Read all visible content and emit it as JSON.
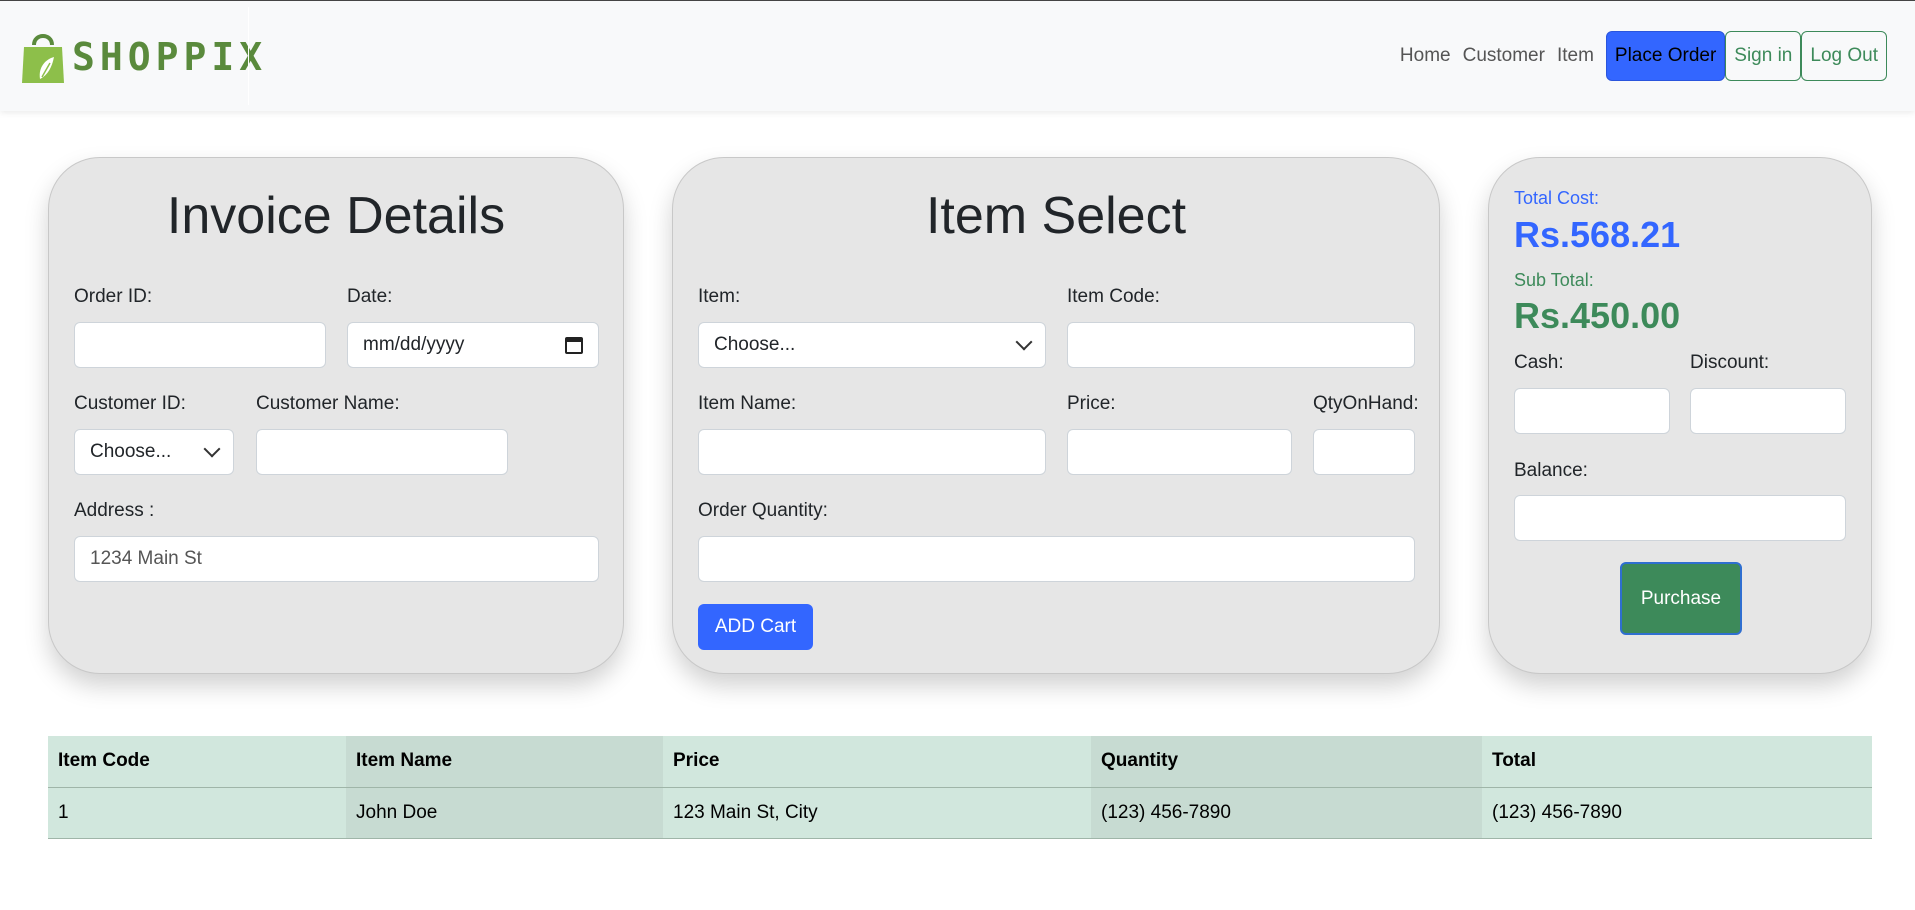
{
  "brand": {
    "name": "SHOPPIX"
  },
  "nav": {
    "links": [
      "Home",
      "Customer",
      "Item"
    ],
    "place_order": "Place Order",
    "sign_in": "Sign in",
    "log_out": "Log Out"
  },
  "invoice": {
    "title": "Invoice Details",
    "order_id_label": "Order ID:",
    "order_id_value": "",
    "date_label": "Date:",
    "date_placeholder": "mm/dd/yyyy",
    "customer_id_label": "Customer ID:",
    "customer_id_selected": "Choose...",
    "customer_name_label": "Customer Name:",
    "customer_name_value": "",
    "address_label": "Address :",
    "address_placeholder": "1234 Main St"
  },
  "item_select": {
    "title": "Item Select",
    "item_label": "Item:",
    "item_selected": "Choose...",
    "item_code_label": "Item Code:",
    "item_name_label": "Item Name:",
    "price_label": "Price:",
    "qty_on_hand_label": "QtyOnHand:",
    "order_qty_label": "Order Quantity:",
    "add_cart": "ADD Cart"
  },
  "summary": {
    "total_cost_label": "Total Cost:",
    "total_cost_value": "Rs.568.21",
    "sub_total_label": "Sub Total:",
    "sub_total_value": "Rs.450.00",
    "cash_label": "Cash:",
    "discount_label": "Discount:",
    "balance_label": "Balance:",
    "purchase": "Purchase"
  },
  "colors": {
    "primary": "#3366ff",
    "success": "#3d8a5a",
    "card_bg": "#e6e6e6",
    "table_bg": "#d1e7dd"
  },
  "cart_table": {
    "headers": [
      "Item Code",
      "Item Name",
      "Price",
      "Quantity",
      "Total"
    ],
    "rows": [
      [
        "1",
        "John Doe",
        "123 Main St, City",
        "(123) 456-7890",
        "(123) 456-7890"
      ]
    ]
  }
}
